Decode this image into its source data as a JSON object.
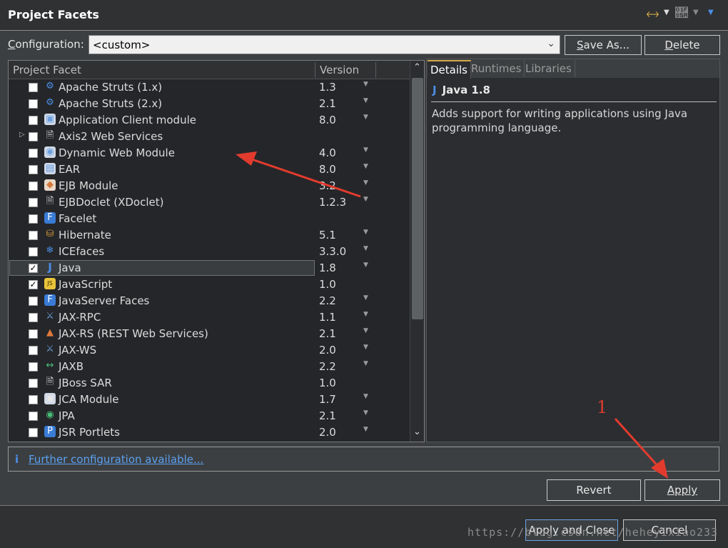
{
  "title": "Project Facets",
  "config": {
    "label_pre": "",
    "label_ul": "C",
    "label_post": "onfiguration:",
    "value": "<custom>",
    "save_as": "Save As...",
    "save_as_ul": "S",
    "save_as_rest": "ave As...",
    "delete_ul": "D",
    "delete_rest": "elete"
  },
  "table": {
    "col_facet": "Project Facet",
    "col_version": "Version",
    "rows": [
      {
        "name": "Apache Struts (1.x)",
        "version": "1.3",
        "checked": false,
        "icon": "gear-icon",
        "drop": true
      },
      {
        "name": "Apache Struts (2.x)",
        "version": "2.1",
        "checked": false,
        "icon": "gear-icon",
        "drop": true
      },
      {
        "name": "Application Client module",
        "version": "8.0",
        "checked": false,
        "icon": "app-client-icon",
        "drop": true
      },
      {
        "name": "Axis2 Web Services",
        "version": "",
        "checked": false,
        "icon": "document-icon",
        "drop": false,
        "expandable": true
      },
      {
        "name": "Dynamic Web Module",
        "version": "4.0",
        "checked": false,
        "icon": "web-module-icon",
        "drop": true
      },
      {
        "name": "EAR",
        "version": "8.0",
        "checked": false,
        "icon": "ear-icon",
        "drop": true
      },
      {
        "name": "EJB Module",
        "version": "3.2",
        "checked": false,
        "icon": "ejb-icon",
        "drop": true
      },
      {
        "name": "EJBDoclet (XDoclet)",
        "version": "1.2.3",
        "checked": false,
        "icon": "document-icon",
        "drop": true
      },
      {
        "name": "Facelet",
        "version": "",
        "checked": false,
        "icon": "facelet-icon",
        "drop": false
      },
      {
        "name": "Hibernate",
        "version": "5.1",
        "checked": false,
        "icon": "database-icon",
        "drop": true
      },
      {
        "name": "ICEfaces",
        "version": "3.3.0",
        "checked": false,
        "icon": "icefaces-icon",
        "drop": true
      },
      {
        "name": "Java",
        "version": "1.8",
        "checked": true,
        "icon": "java-icon",
        "drop": true,
        "selected": true
      },
      {
        "name": "JavaScript",
        "version": "1.0",
        "checked": true,
        "icon": "javascript-icon",
        "drop": false
      },
      {
        "name": "JavaServer Faces",
        "version": "2.2",
        "checked": false,
        "icon": "faces-icon",
        "drop": true
      },
      {
        "name": "JAX-RPC",
        "version": "1.1",
        "checked": false,
        "icon": "flask-icon",
        "drop": true
      },
      {
        "name": "JAX-RS (REST Web Services)",
        "version": "2.1",
        "checked": false,
        "icon": "rest-icon",
        "drop": true
      },
      {
        "name": "JAX-WS",
        "version": "2.0",
        "checked": false,
        "icon": "flask-icon",
        "drop": true
      },
      {
        "name": "JAXB",
        "version": "2.2",
        "checked": false,
        "icon": "jaxb-icon",
        "drop": true
      },
      {
        "name": "JBoss SAR",
        "version": "1.0",
        "checked": false,
        "icon": "document-icon",
        "drop": false
      },
      {
        "name": "JCA Module",
        "version": "1.7",
        "checked": false,
        "icon": "jca-icon",
        "drop": true
      },
      {
        "name": "JPA",
        "version": "2.1",
        "checked": false,
        "icon": "jpa-icon",
        "drop": true
      },
      {
        "name": "JSR Portlets",
        "version": "2.0",
        "checked": false,
        "icon": "portlet-icon",
        "drop": true
      }
    ]
  },
  "details": {
    "tabs": [
      "Details",
      "Runtimes",
      "Libraries"
    ],
    "heading": "Java 1.8",
    "heading_icon": "J",
    "description": "Adds support for writing applications using Java programming language."
  },
  "further": {
    "icon": "i",
    "link": "Further configuration available..."
  },
  "buttons": {
    "revert": "Revert",
    "apply_ul": "A",
    "apply_rest": "pply",
    "apply_close": "Apply and Close",
    "cancel": "Cancel"
  },
  "annotation": {
    "number": "1"
  },
  "watermark": "https://blog.csdn.net/heheyixiao233",
  "colors": {
    "accent": "#4a8fe7",
    "arrow": "#e23b2e",
    "background": "#3c3f41"
  }
}
